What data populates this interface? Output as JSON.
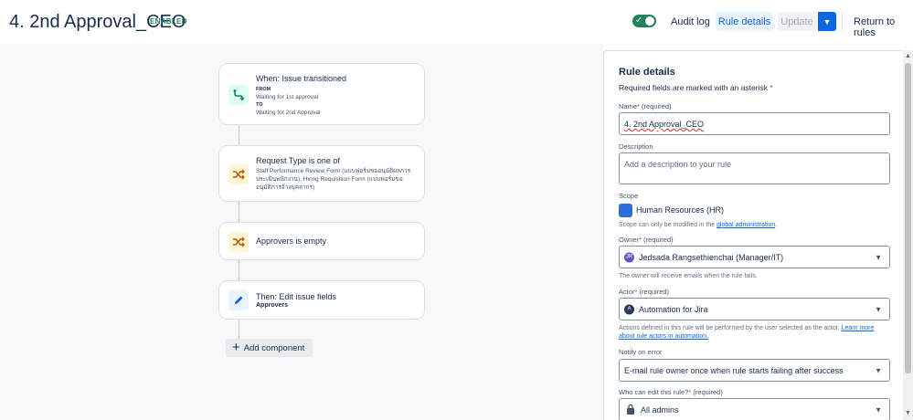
{
  "header": {
    "title": "4. 2nd Approval_CEO",
    "status_badge": "ENABLED",
    "toggle_on": true,
    "audit_log": "Audit log",
    "rule_details": "Rule details",
    "update": "Update",
    "return_to_rules": "Return to rules"
  },
  "canvas": {
    "trigger": {
      "title": "When: Issue transitioned",
      "from_label": "FROM",
      "from_value": "Waiting for 1st approval",
      "to_label": "TO",
      "to_value": "Waiting for 2nd Approval"
    },
    "condition1": {
      "title": "Request Type is one of",
      "detail": "Staff Performance Review Form (แบบฟอร์มขออนุมัติผลการประเมินพนักงาน), Hiring Requisition Form (แบบฟอร์มขออนุมัติการจ้างบุคลากร)"
    },
    "condition2": {
      "title": "Approvers is empty"
    },
    "action": {
      "title": "Then: Edit issue fields",
      "detail": "Approvers"
    },
    "add_component": "Add component"
  },
  "panel": {
    "title": "Rule details",
    "required_note": "Required fields are marked with an asterisk",
    "asterisk": "*",
    "name": {
      "label": "Name",
      "req": "(required)",
      "value": "4. 2nd Approval_CEO"
    },
    "description": {
      "label": "Description",
      "placeholder": "Add a description to your rule"
    },
    "scope": {
      "label": "Scope",
      "value": "Human Resources (HR)",
      "helper_prefix": "Scope can only be modified in the",
      "helper_link": "global administration",
      "helper_suffix": "."
    },
    "owner": {
      "label": "Owner",
      "req": "(required)",
      "value": "Jedsada Rangsethienchai (Manager/IT)",
      "avatar_initials": "JR",
      "helper": "The owner will receive emails when the rule fails."
    },
    "actor": {
      "label": "Actor",
      "req": "(required)",
      "value": "Automation for Jira",
      "avatar_initials": "A",
      "helper_text": "Actions defined in this rule will be performed by the user selected as the actor.",
      "helper_link": "Learn more about rule actors in automation."
    },
    "notify": {
      "label": "Notify on error",
      "value": "E-mail rule owner once when rule starts failing after success"
    },
    "who_can_edit": {
      "label": "Who can edit this rule?",
      "req": "(required)",
      "value": "All admins"
    }
  },
  "colors": {
    "enabled_green": "#1f845a",
    "primary_blue": "#0c66e4",
    "trigger_icon_bg": "#dcfff1",
    "condition_icon_bg": "#fff7d6",
    "action_icon_bg": "#e9f2ff"
  },
  "icons": {
    "trigger": "branch-transition-icon",
    "condition": "shuffle-icon",
    "action": "pencil-icon",
    "add": "plus-icon",
    "lock": "lock-icon",
    "dropdown": "chevron-down-icon"
  }
}
